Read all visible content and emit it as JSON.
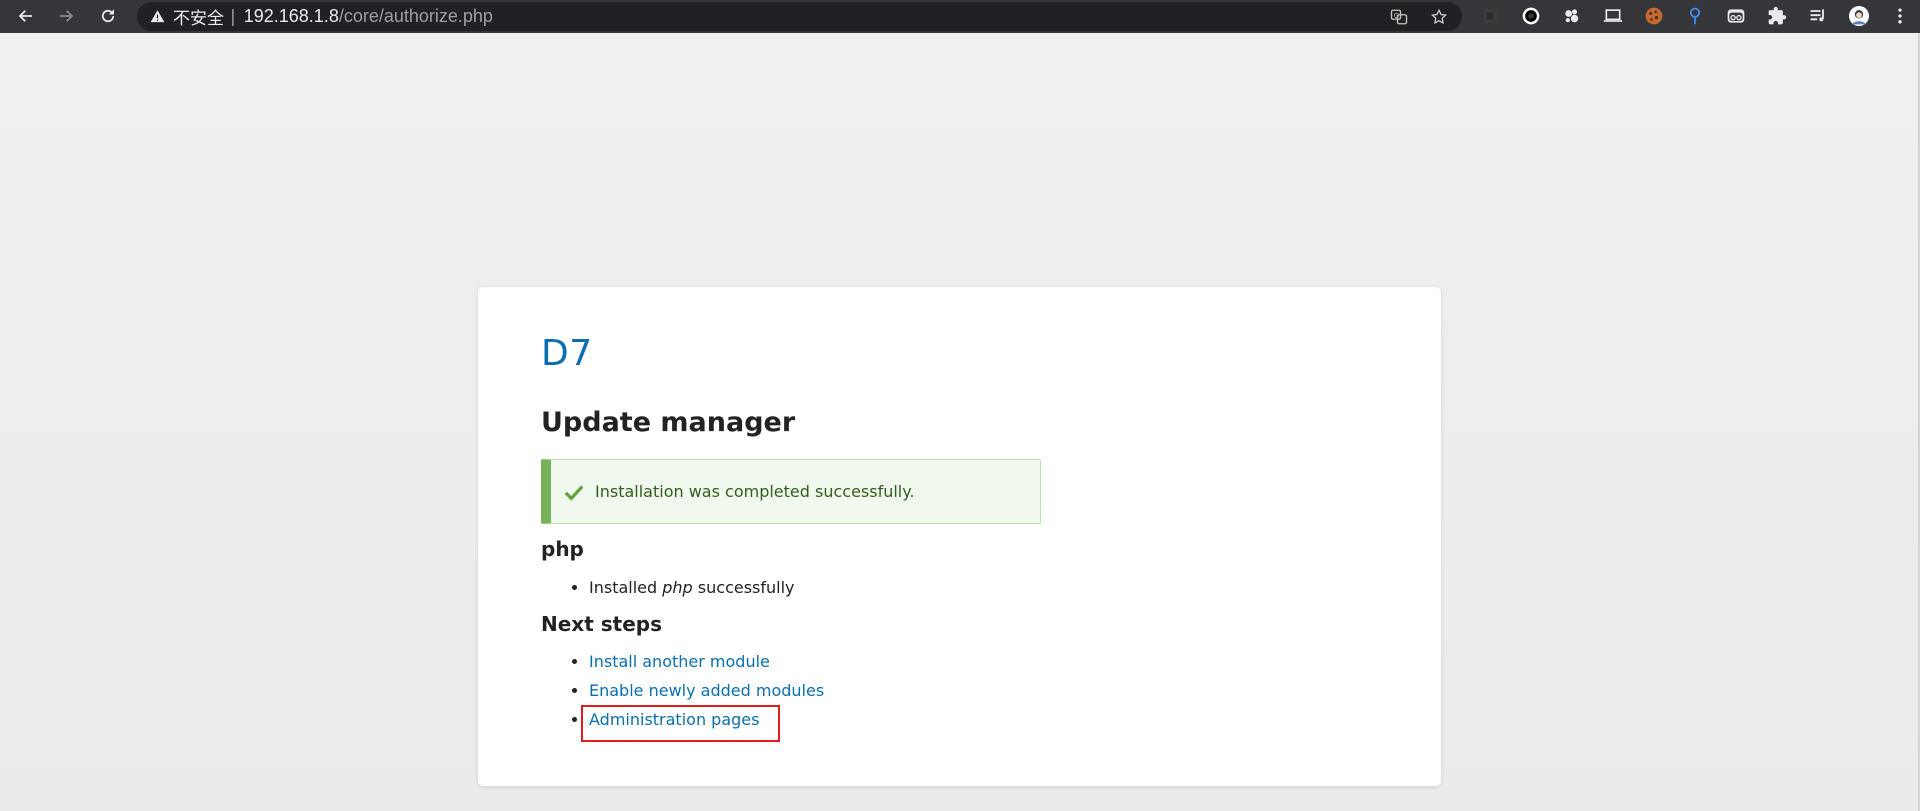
{
  "browser": {
    "security_label": "不安全",
    "separator": "|",
    "url_host": "192.168.1.8",
    "url_path": "/core/authorize.php"
  },
  "icons": {
    "back": "arrow-left-icon",
    "forward": "arrow-right-icon",
    "reload": "reload-icon",
    "warning": "warning-icon",
    "translate": "translate-icon",
    "bookmark": "star-icon",
    "extensions": [
      "dark-extension-icon",
      "circle-extension-icon",
      "cluster-extension-icon",
      "laptop-icon",
      "cookie-icon",
      "pin-icon",
      "goggles-icon",
      "puzzle-icon",
      "playlist-icon",
      "avatar",
      "kebab-menu-icon"
    ]
  },
  "page": {
    "site_name": "D7",
    "title": "Update manager",
    "status_message": "Installation was completed successfully.",
    "php_section": {
      "heading": "php",
      "item_prefix": "Installed ",
      "item_em": "php",
      "item_suffix": " successfully"
    },
    "next_steps": {
      "heading": "Next steps",
      "links": [
        "Install another module",
        "Enable newly added modules",
        "Administration pages"
      ]
    }
  },
  "colors": {
    "link": "#0a6fb1",
    "status_border": "#77b259",
    "status_bg": "#f1f8ee",
    "highlight": "#e01e1e"
  }
}
